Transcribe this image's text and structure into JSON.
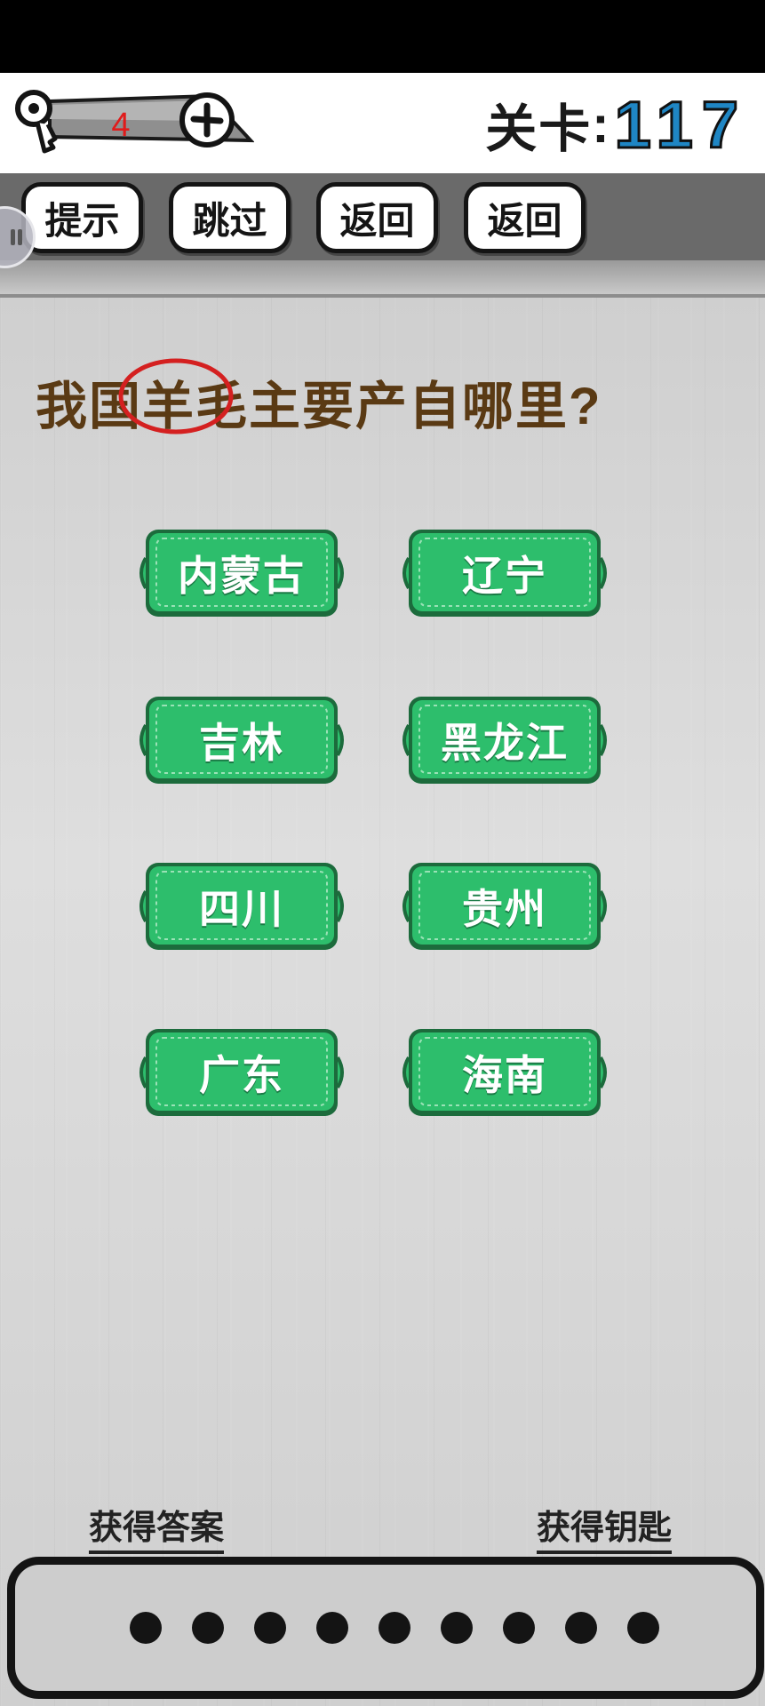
{
  "header": {
    "key_count": "4",
    "level_label": "关卡",
    "level_separator": ":",
    "level_number": "117"
  },
  "toolbar": {
    "hint_label": "提示",
    "skip_label": "跳过",
    "back_label_1": "返回",
    "back_label_2": "返回"
  },
  "question": {
    "text": "我国羊毛主要产自哪里?"
  },
  "options": [
    {
      "label": "内蒙古"
    },
    {
      "label": "辽宁"
    },
    {
      "label": "吉林"
    },
    {
      "label": "黑龙江"
    },
    {
      "label": "四川"
    },
    {
      "label": "贵州"
    },
    {
      "label": "广东"
    },
    {
      "label": "海南"
    }
  ],
  "footer": {
    "get_answer_label": "获得答案",
    "get_key_label": "获得钥匙",
    "answer_slots": 9
  },
  "colors": {
    "option_green": "#2dbe6c",
    "option_border": "#1c6b3c",
    "question_brown": "#5a3a14",
    "level_blue": "#1f86c4",
    "key_count_red": "#e01b1b",
    "circle_red": "#d42020"
  },
  "icons": [
    "key-icon",
    "plus-icon"
  ]
}
